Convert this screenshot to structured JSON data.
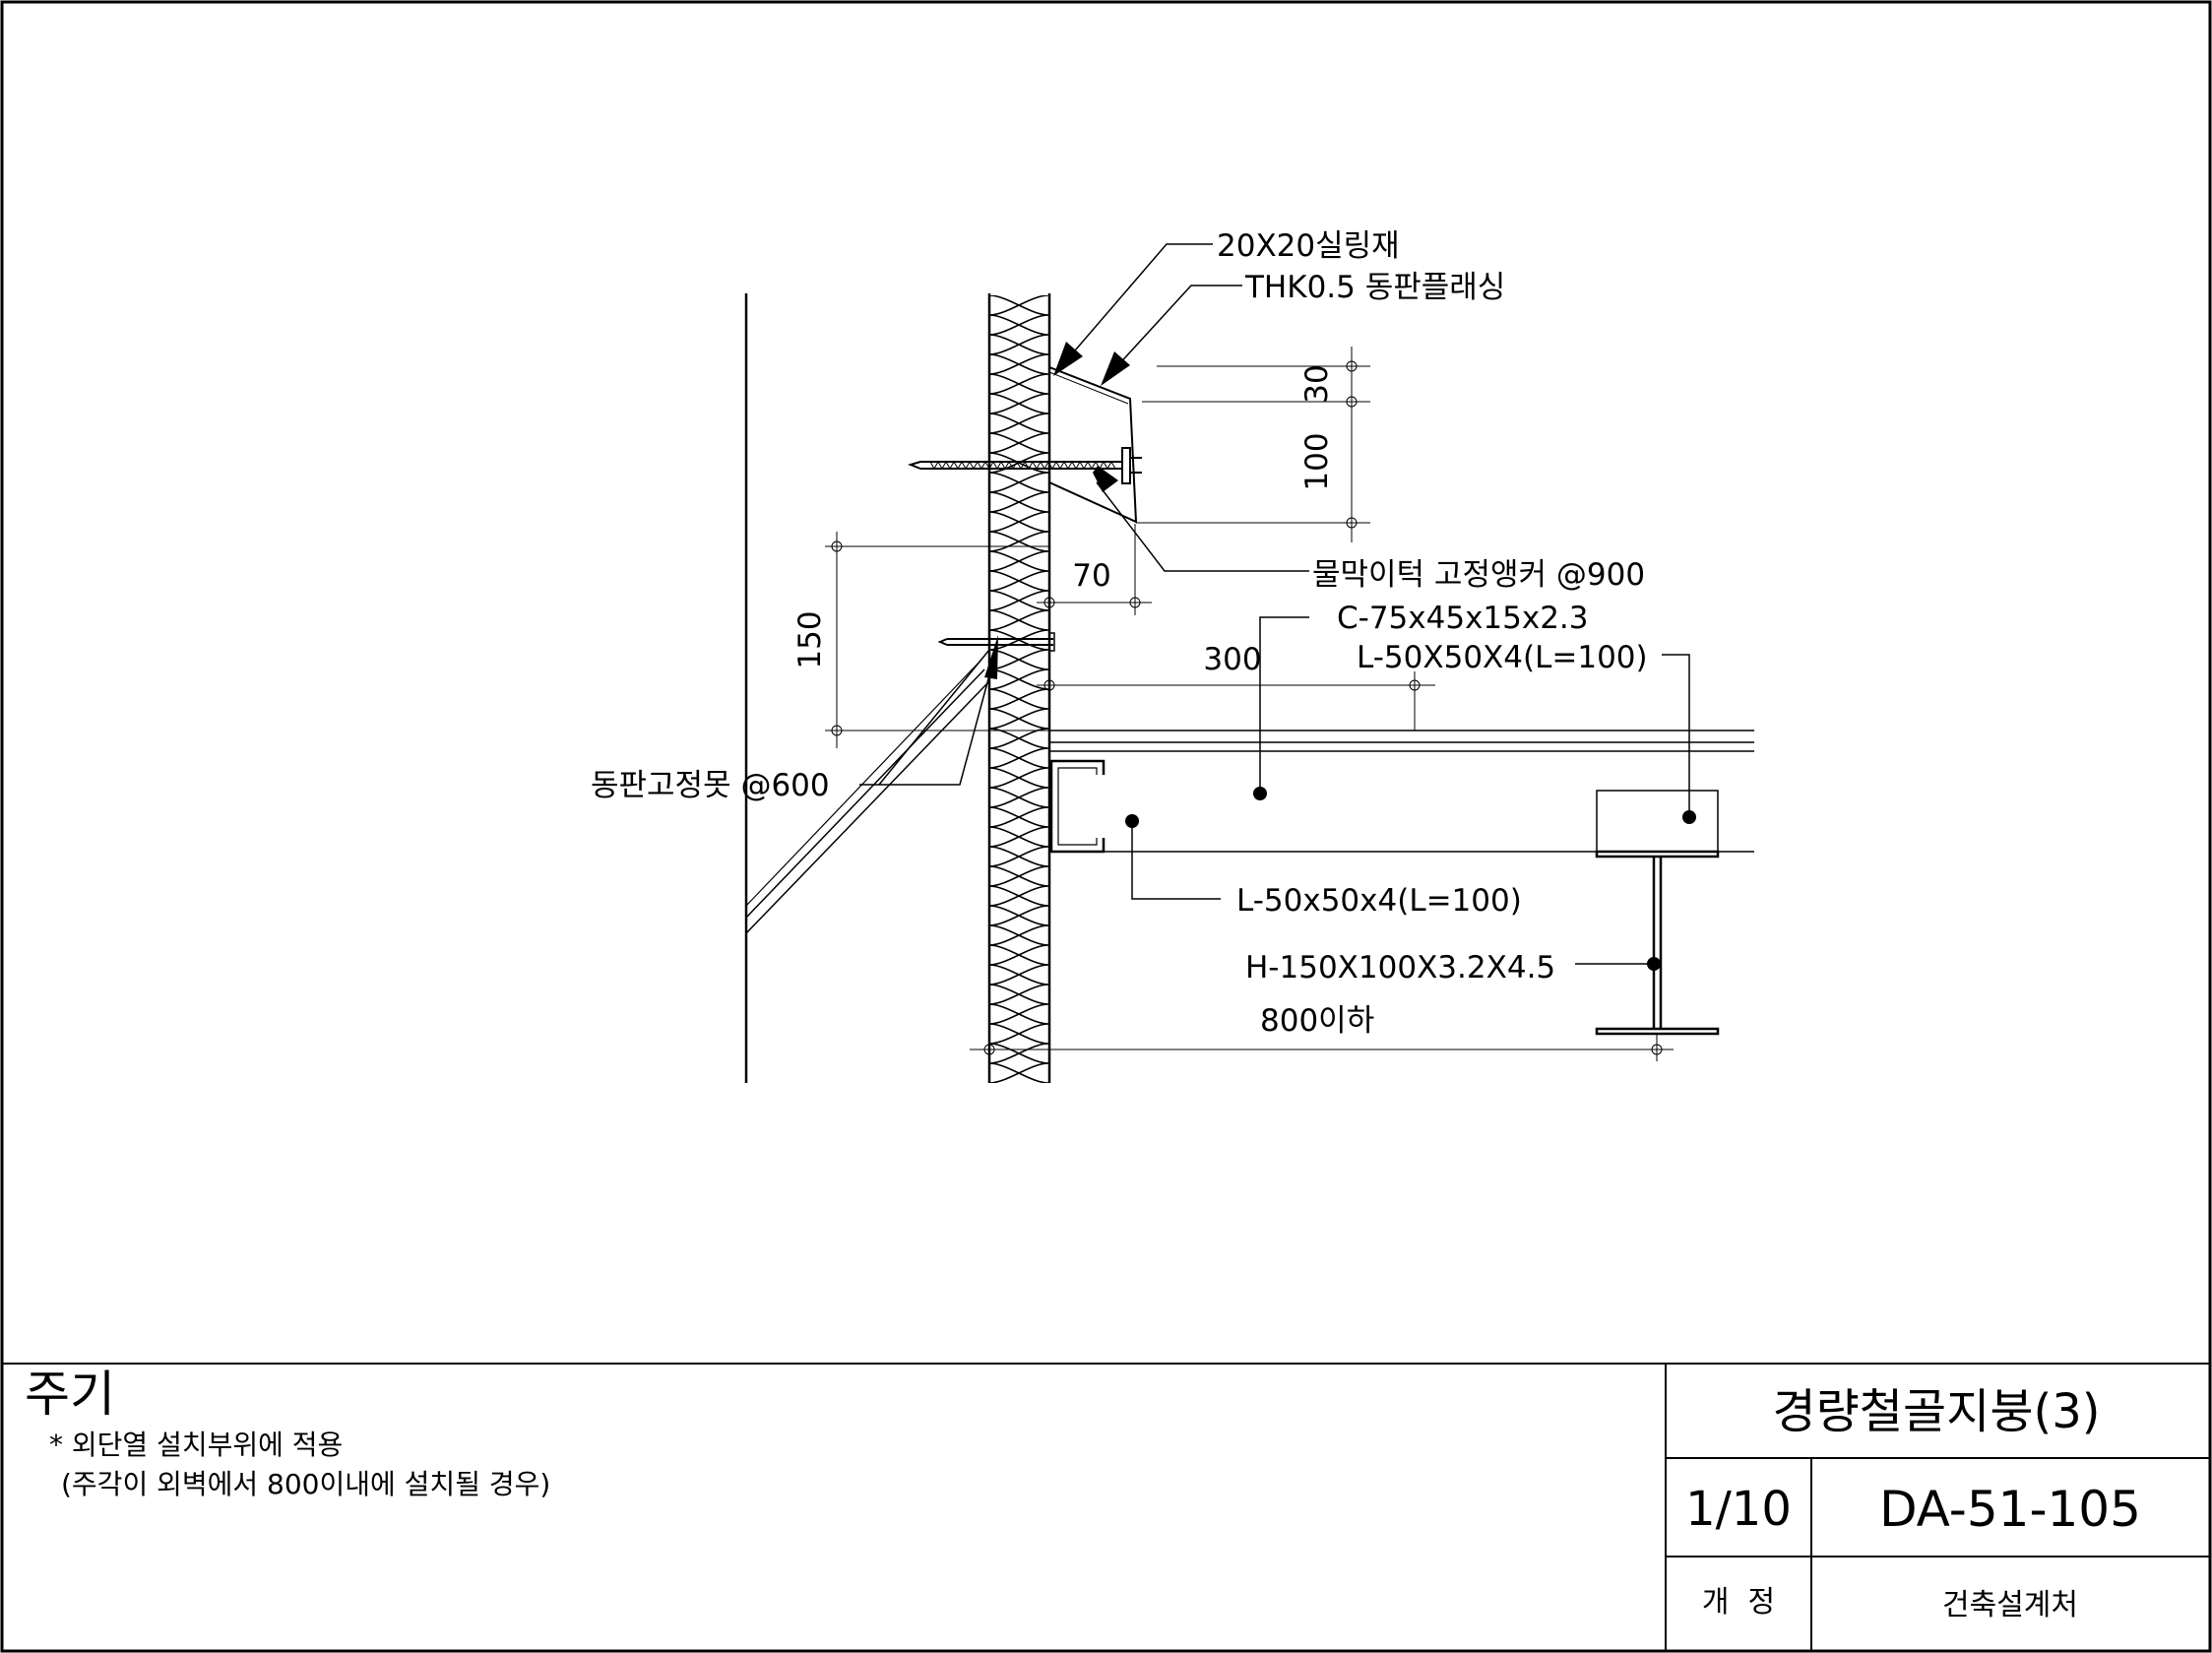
{
  "labels": {
    "sealant": "20X20실링재",
    "flashing": "THK0.5 동판플래싱",
    "anchor": "물막이턱 고정앵커 @900",
    "channel": "C-75x45x15x2.3",
    "angle_upper": "L-50X50X4(L=100)",
    "nail": "동판고정못 @600",
    "angle_lower": "L-50x50x4(L=100)",
    "hbeam": "H-150X100X3.2X4.5",
    "span": "800이하"
  },
  "dimensions": {
    "d30": "30",
    "d100": "100",
    "d70": "70",
    "d150": "150",
    "d300": "300"
  },
  "notes": {
    "title": "주기",
    "line1": "* 외단열 설치부위에 적용",
    "line2": "(주각이 외벽에서 800이내에 설치될 경우)"
  },
  "title_block": {
    "title": "경량철골지붕(3)",
    "scale": "1/10",
    "drawing_no": "DA-51-105",
    "revision_label": "개  정",
    "office": "건축설계처"
  }
}
